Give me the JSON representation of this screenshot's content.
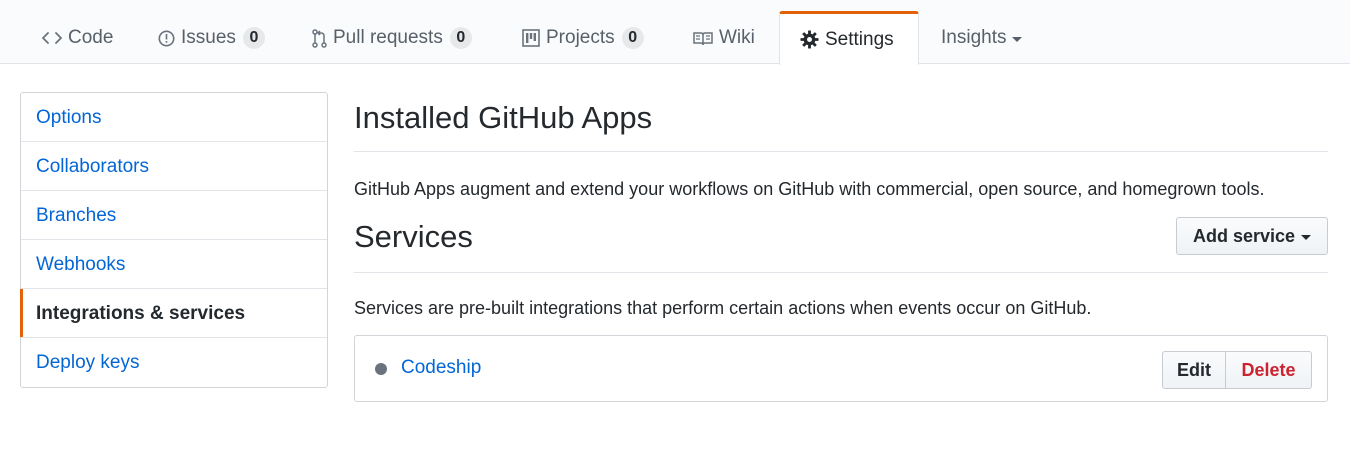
{
  "repo_nav": {
    "tabs": [
      {
        "label": "Code",
        "icon": "code-icon"
      },
      {
        "label": "Issues",
        "icon": "issue-opened-icon",
        "count": "0"
      },
      {
        "label": "Pull requests",
        "icon": "git-pull-request-icon",
        "count": "0"
      },
      {
        "label": "Projects",
        "icon": "project-icon",
        "count": "0"
      },
      {
        "label": "Wiki",
        "icon": "book-icon"
      },
      {
        "label": "Settings",
        "icon": "gear-icon",
        "selected": true
      },
      {
        "label": "Insights",
        "icon": "chevron-down-icon"
      }
    ]
  },
  "sidebar": {
    "items": [
      {
        "label": "Options"
      },
      {
        "label": "Collaborators"
      },
      {
        "label": "Branches"
      },
      {
        "label": "Webhooks"
      },
      {
        "label": "Integrations & services",
        "selected": true
      },
      {
        "label": "Deploy keys"
      }
    ]
  },
  "github_apps": {
    "title": "Installed GitHub Apps",
    "description": "GitHub Apps augment and extend your workflows on GitHub with commercial, open source, and homegrown tools."
  },
  "services": {
    "title": "Services",
    "add_button_label": "Add service",
    "description": "Services are pre-built integrations that perform certain actions when events occur on GitHub.",
    "items": [
      {
        "name": "Codeship",
        "edit_label": "Edit",
        "delete_label": "Delete",
        "status_color": "#6a737d"
      }
    ]
  },
  "colors": {
    "accent": "#e36209",
    "link": "#0366d6",
    "danger": "#cb2431"
  }
}
